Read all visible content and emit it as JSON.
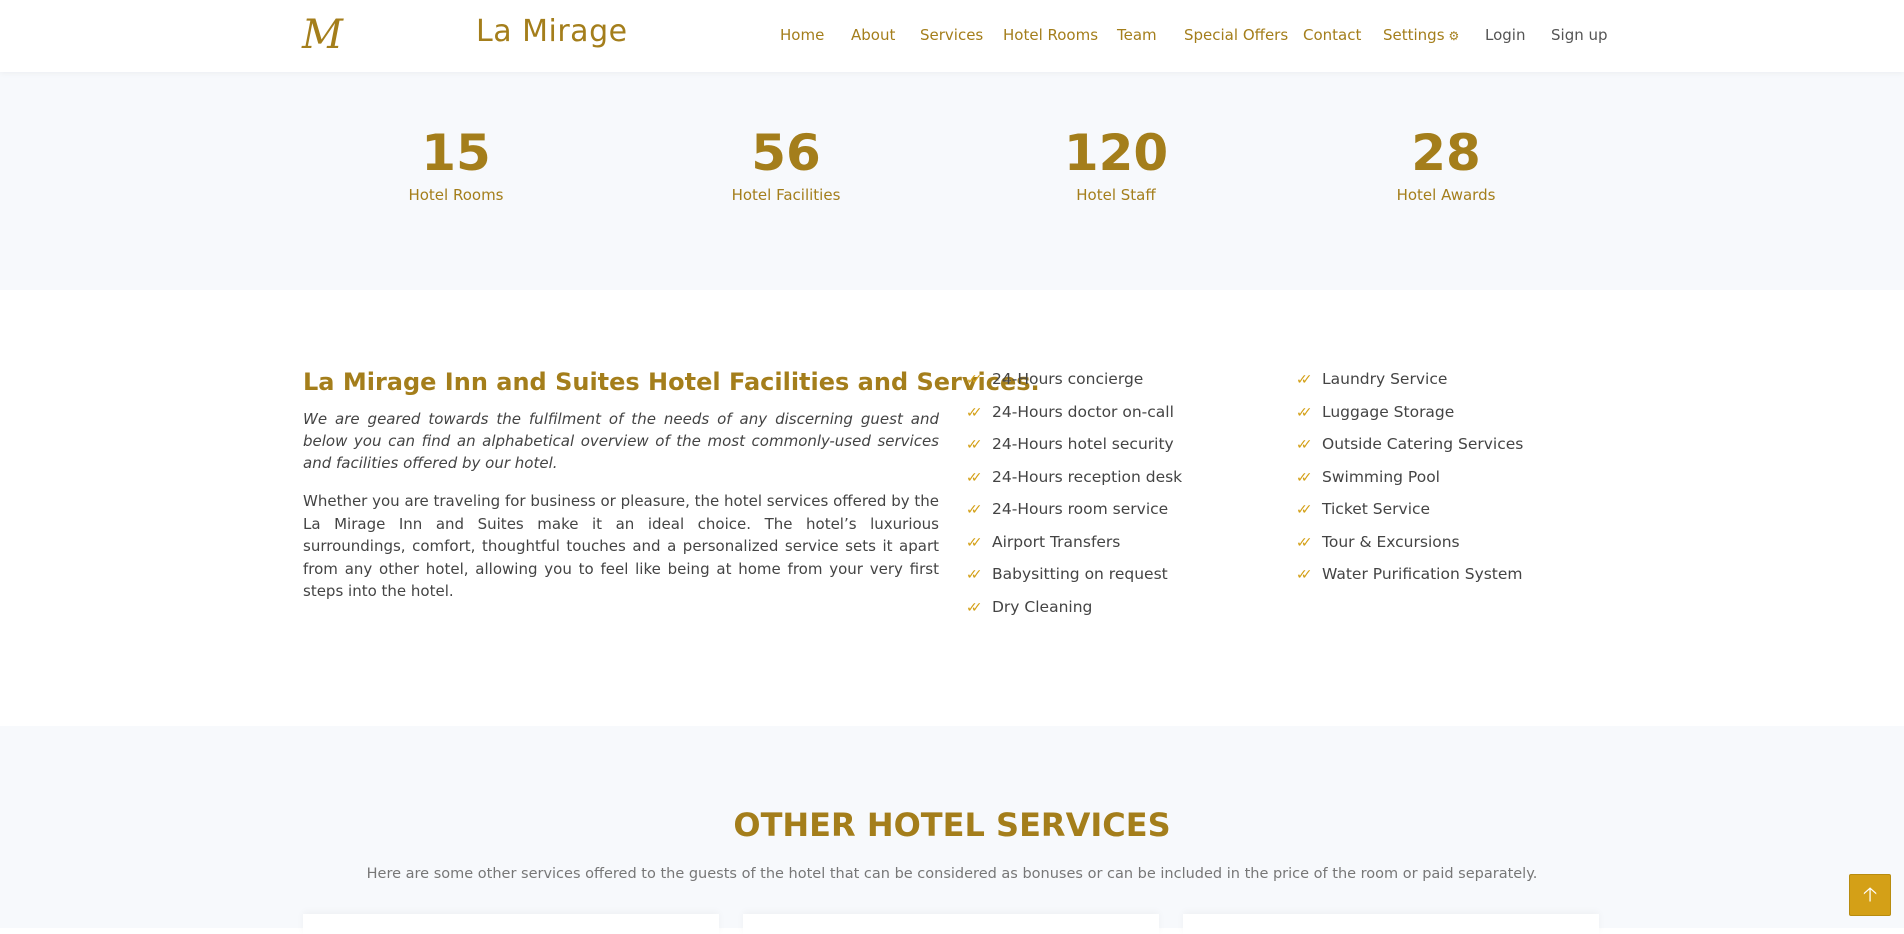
{
  "header": {
    "logo_text": "M",
    "brand": "La Mirage",
    "nav": [
      {
        "label": "Home"
      },
      {
        "label": "About"
      },
      {
        "label": "Services"
      },
      {
        "label": "Hotel Rooms"
      },
      {
        "label": "Team"
      },
      {
        "label": "Special Offers"
      },
      {
        "label": "Contact"
      },
      {
        "label": "Settings"
      },
      {
        "label": "Login"
      },
      {
        "label": "Sign up"
      }
    ]
  },
  "stats": [
    {
      "value": "15",
      "label": "Hotel Rooms"
    },
    {
      "value": "56",
      "label": "Hotel Facilities"
    },
    {
      "value": "120",
      "label": "Hotel Staff"
    },
    {
      "value": "28",
      "label": "Hotel Awards"
    }
  ],
  "facilities": {
    "title": "La Mirage Inn and Suites Hotel Facilities and Services.",
    "intro": "We are geared towards the fulfilment of the needs of any discerning guest and below you can find an alphabetical overview of the most commonly-used services and facilities offered by our hotel.",
    "body": "Whether you are traveling for business or pleasure, the hotel services offered by the La Mirage Inn and Suites make it an ideal choice. The hotel’s luxurious surroundings, comfort, thoughtful touches and a personalized service sets it apart from any other hotel, allowing you to feel like being at home from your very first steps into the hotel.",
    "list_left": [
      "24-Hours concierge",
      "24-Hours doctor on-call",
      "24-Hours hotel security",
      "24-Hours reception desk",
      "24-Hours room service",
      "Airport Transfers",
      "Babysitting on request",
      "Dry Cleaning"
    ],
    "list_right": [
      "Laundry Service",
      "Luggage Storage",
      "Outside Catering Services",
      "Swimming Pool",
      "Ticket Service",
      "Tour & Excursions",
      "Water Purification System"
    ]
  },
  "other_services": {
    "title": "OTHER HOTEL SERVICES",
    "subtitle": "Here are some other services offered to the guests of the hotel that can be considered as bonuses or can be included in the price of the room or paid separately."
  },
  "back_to_top": {
    "icon": "arrow-up-icon",
    "glyph": "🡡"
  },
  "colors": {
    "accent": "#a47e1b",
    "button": "#d4a017",
    "section_bg": "#f7f9fc"
  }
}
